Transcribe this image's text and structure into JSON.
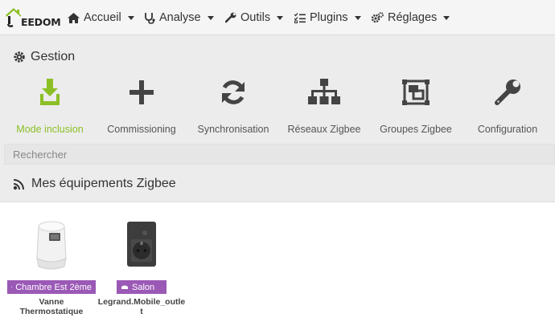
{
  "brand": {
    "logo_text": "EEDOM",
    "accent": "#8cbf26"
  },
  "nav": [
    {
      "label": "Accueil",
      "icon": "home-icon"
    },
    {
      "label": "Analyse",
      "icon": "stethoscope-icon"
    },
    {
      "label": "Outils",
      "icon": "wrench-icon"
    },
    {
      "label": "Plugins",
      "icon": "tasks-icon"
    },
    {
      "label": "Réglages",
      "icon": "cogs-icon"
    }
  ],
  "gestion": {
    "title": "Gestion",
    "actions": [
      {
        "label": "Mode inclusion",
        "icon": "download-icon",
        "active": true
      },
      {
        "label": "Commissioning",
        "icon": "plus-icon"
      },
      {
        "label": "Synchronisation",
        "icon": "sync-icon"
      },
      {
        "label": "Réseaux Zigbee",
        "icon": "sitemap-icon"
      },
      {
        "label": "Groupes Zigbee",
        "icon": "object-group-icon"
      },
      {
        "label": "Configuration",
        "icon": "wrench-icon"
      }
    ]
  },
  "search": {
    "placeholder": "Rechercher",
    "value": ""
  },
  "equipments": {
    "title": "Mes équipements Zigbee",
    "items": [
      {
        "room": "Chambre Est 2ème",
        "name_line1": "Vanne",
        "name_line2": "Thermostatique",
        "badge_color": "#9b59b6"
      },
      {
        "room": "Salon",
        "name_line1": "Legrand.Mobile_outle",
        "name_line2": "t",
        "badge_color": "#9b59b6"
      }
    ]
  }
}
